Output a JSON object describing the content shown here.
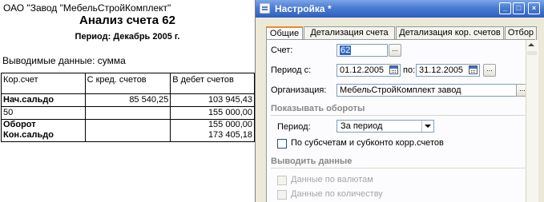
{
  "report": {
    "organization": "ОАО \"Завод \"МебельСтройКомплект\"",
    "title": "Анализ счета 62",
    "period": "Период: Декабрь 2005 г.",
    "output_label": "Выводимые данные: сумма",
    "columns": [
      "Кор.счет",
      "С кред. счетов",
      "В дебет счетов"
    ],
    "rows": [
      {
        "account": "Нач.сальдо",
        "credit": "85 540,25",
        "debit": "103 945,43"
      },
      {
        "account": "50",
        "credit": "",
        "debit": "155 000,00"
      },
      {
        "account": "Оборот",
        "credit": "",
        "debit": "155 000,00"
      },
      {
        "account": "Кон.сальдо",
        "credit": "",
        "debit": "173 405,18"
      }
    ]
  },
  "settings": {
    "window_title": "Настройка *",
    "tabs": [
      "Общие",
      "Детализация счета",
      "Детализация кор. счетов",
      "Отбор"
    ],
    "account_label": "Счет:",
    "account_value": "62",
    "period_from_label": "Период с:",
    "period_from_value": "01.12.2005",
    "period_to_label": "по:",
    "period_to_value": "31.12.2005",
    "org_label": "Организация:",
    "org_value": "МебельСтройКомплект завод",
    "show_turnovers_section": "Показывать обороты",
    "turnover_period_label": "Период:",
    "turnover_period_value": "За период",
    "subaccounts_checkbox": "По субсчетам и субконто корр.счетов",
    "output_section": "Выводить данные",
    "currency_checkbox": "Данные по валютам",
    "quantity_checkbox": "Данные по количеству",
    "ellipsis": "...",
    "dropdown_glyph": "..."
  },
  "colors": {
    "titlebar": "#2e5fbe",
    "selection": "#316ac5",
    "window_bg": "#ece9d8",
    "active_tab_accent": "#e68b2c"
  }
}
